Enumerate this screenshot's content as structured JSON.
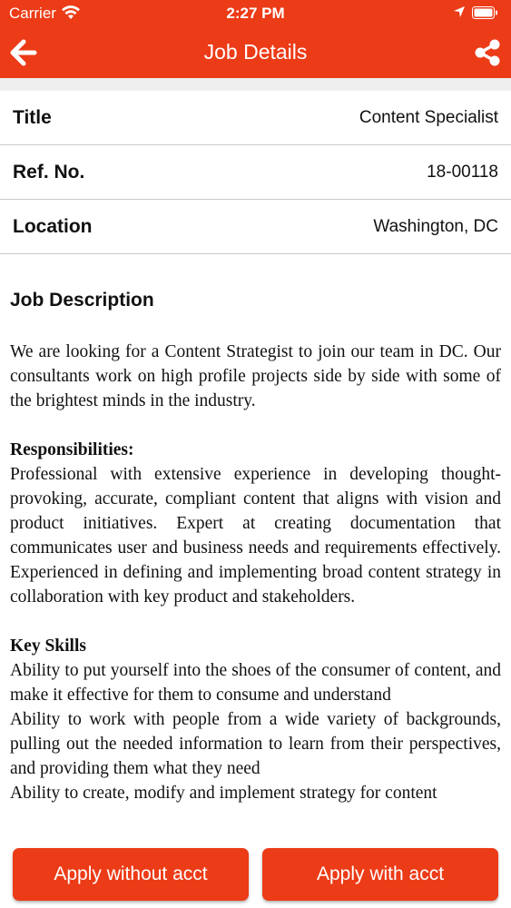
{
  "status": {
    "carrier": "Carrier",
    "time": "2:27 PM"
  },
  "nav": {
    "title": "Job Details",
    "back_icon": "back-arrow-icon",
    "share_icon": "share-icon"
  },
  "details": [
    {
      "label": "Title",
      "value": "Content Specialist"
    },
    {
      "label": "Ref. No.",
      "value": "18-00118"
    },
    {
      "label": "Location",
      "value": "Washington, DC"
    }
  ],
  "description": {
    "heading": "Job Description",
    "intro": "We are looking for a Content Strategist to join our team in DC. Our consultants work on high profile projects side by side with some of the brightest minds in the industry.",
    "responsibilities_heading": "Responsibilities:",
    "responsibilities": "Professional with extensive experience in developing thought-provoking, accurate, compliant content that aligns with vision and product initiatives. Expert at creating documentation that communicates user and business needs and requirements effectively. Experienced in defining and implementing broad content strategy in collaboration with key product and stakeholders.",
    "skills_heading": "Key Skills",
    "skills": [
      "Ability to put yourself into the shoes of the consumer of content, and make it effective for them to consume and understand",
      "Ability to work with people from a wide variety of backgrounds, pulling out the needed information to learn from their perspectives, and providing them what they need",
      "Ability to create, modify and implement strategy for content"
    ]
  },
  "actions": {
    "apply_without": "Apply without acct",
    "apply_with": "Apply with acct"
  },
  "colors": {
    "accent": "#ec3b17",
    "divider": "#c9c9c9"
  }
}
